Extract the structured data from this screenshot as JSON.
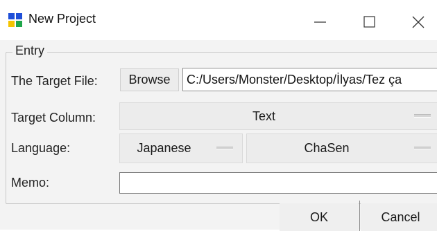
{
  "window": {
    "title": "New Project",
    "icon": "grid-app-icon",
    "controls": [
      "minimize-icon",
      "maximize-icon",
      "close-icon"
    ]
  },
  "entry": {
    "group_label": "Entry",
    "target_file": {
      "label": "The Target File:",
      "browse_label": "Browse",
      "path_value": "C:/Users/Monster/Desktop/İlyas/Tez ça"
    },
    "target_column": {
      "label": "Target Column:",
      "selected": "Text"
    },
    "language": {
      "label": "Language:",
      "selected": "Japanese",
      "analyzer_selected": "ChaSen"
    },
    "memo": {
      "label": "Memo:",
      "value": ""
    }
  },
  "footer": {
    "ok_label": "OK",
    "cancel_label": "Cancel"
  },
  "colors": {
    "icon_blue": "#1f4fd8",
    "icon_yellow": "#f5c400",
    "icon_green": "#1fa64a",
    "close_red": "#e81123"
  }
}
